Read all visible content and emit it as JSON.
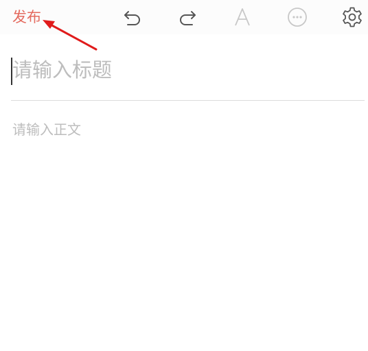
{
  "toolbar": {
    "publish_label": "发布",
    "icons": [
      "undo-icon",
      "redo-icon",
      "font-icon",
      "more-icon",
      "settings-icon"
    ]
  },
  "editor": {
    "title_placeholder": "请输入标题",
    "body_placeholder": "请输入正文"
  },
  "colors": {
    "accent": "#e46b5f",
    "annotation_arrow": "#e01b1b",
    "placeholder": "#bdbdbd"
  }
}
